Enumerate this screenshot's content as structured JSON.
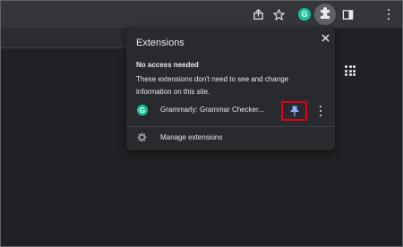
{
  "toolbar": {
    "icons": [
      "share-icon",
      "star-icon",
      "grammarly-extension-icon",
      "extensions-puzzle-icon",
      "side-panel-icon",
      "chrome-menu-icon"
    ],
    "grammarly_letter": "G"
  },
  "popup": {
    "title": "Extensions",
    "section_heading": "No access needed",
    "section_description": "These extensions don't need to see and change information on this site.",
    "extensions": [
      {
        "name": "Grammarly: Grammar Checker...",
        "icon": "grammarly-icon",
        "icon_letter": "G"
      }
    ],
    "manage_label": "Manage extensions"
  },
  "colors": {
    "page_background": "#202124",
    "toolbar": "#35363a",
    "popup_background": "#292a2d",
    "text": "#e8eaed",
    "grammarly_green": "#15c39a",
    "pin_blue": "#8ab4f8",
    "highlight_red": "#e0001a"
  }
}
